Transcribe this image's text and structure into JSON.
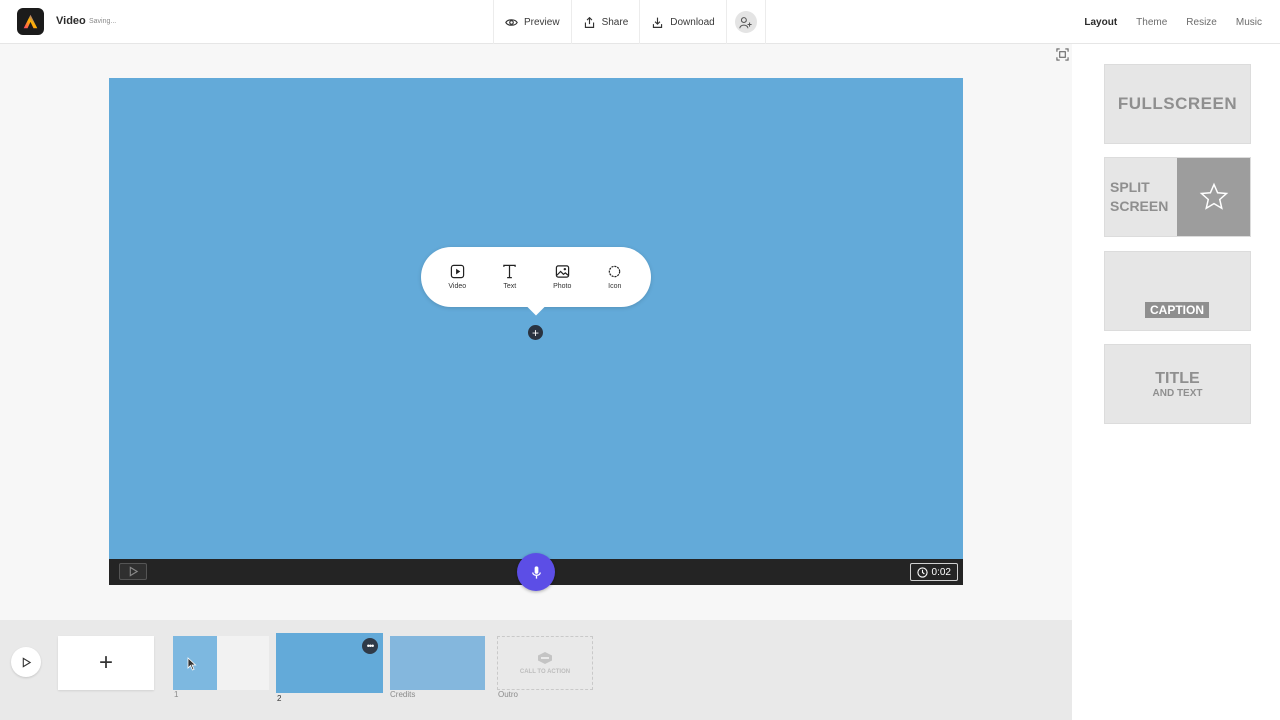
{
  "header": {
    "app_title": "Video",
    "status": "Saving...",
    "actions": [
      {
        "label": "Preview",
        "icon": "eye-icon"
      },
      {
        "label": "Share",
        "icon": "share-icon"
      },
      {
        "label": "Download",
        "icon": "download-icon"
      }
    ],
    "invite_icon": "add-person-icon",
    "tabs": [
      {
        "label": "Layout",
        "active": true
      },
      {
        "label": "Theme",
        "active": false
      },
      {
        "label": "Resize",
        "active": false
      },
      {
        "label": "Music",
        "active": false
      }
    ]
  },
  "canvas": {
    "background": "#63aad9",
    "bubble_items": [
      {
        "label": "Video",
        "icon": "video-play-icon"
      },
      {
        "label": "Text",
        "icon": "text-icon"
      },
      {
        "label": "Photo",
        "icon": "photo-icon"
      },
      {
        "label": "Icon",
        "icon": "badge-icon"
      }
    ],
    "add_symbol": "+",
    "duration": "0:02",
    "mic_color": "#5c4ee6"
  },
  "layouts": {
    "fullscreen": "FULLSCREEN",
    "split_line1": "SPLIT",
    "split_line2": "SCREEN",
    "caption": "CAPTION",
    "title_main": "TITLE",
    "title_sub": "AND TEXT"
  },
  "timeline": {
    "add_symbol": "+",
    "clips": [
      {
        "label": "1"
      },
      {
        "label": "2",
        "selected": true
      },
      {
        "label": "Credits"
      },
      {
        "label": "Outro"
      }
    ],
    "outro_cta": "CALL TO ACTION",
    "clip_menu": "•••"
  }
}
